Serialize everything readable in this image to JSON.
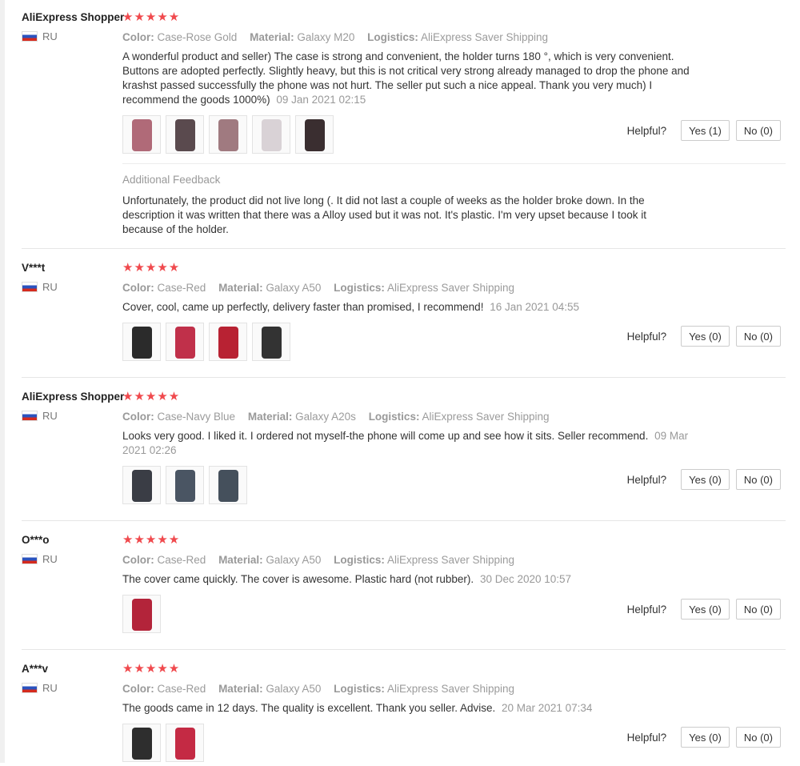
{
  "reviews": [
    {
      "user": "AliExpress Shopper",
      "country": "RU",
      "stars": "★★★★★",
      "color_label": "Color:",
      "color": "Case-Rose Gold",
      "material_label": "Material:",
      "material": "Galaxy M20",
      "logistics_label": "Logistics:",
      "logistics": "AliExpress Saver Shipping",
      "text": "A wonderful product and seller) The case is strong and convenient, the holder turns 180 °, which is very convenient. Buttons are adopted perfectly. Slightly heavy, but this is not critical very strong already managed to drop the phone and krashst passed successfully the phone was not hurt. The seller put such a nice appeal. Thank you very much) I recommend the goods 1000%)",
      "date": "09 Jan 2021 02:15",
      "helpful_label": "Helpful?",
      "yes": "Yes (1)",
      "no": "No (0)",
      "additional_title": "Additional Feedback",
      "additional_text": "Unfortunately, the product did not live long (. It did not last a couple of weeks as the holder broke down. In the description it was written that there was a Alloy used but it was not. It's plastic. I'm very upset because I took it because of the holder.",
      "photo_colors": [
        "#b06a78",
        "#5a4a4e",
        "#a07a80",
        "#d9d2d6",
        "#3a2e30"
      ]
    },
    {
      "user": "V***t",
      "country": "RU",
      "stars": "★★★★★",
      "color_label": "Color:",
      "color": "Case-Red",
      "material_label": "Material:",
      "material": "Galaxy A50",
      "logistics_label": "Logistics:",
      "logistics": "AliExpress Saver Shipping",
      "text": "Cover, cool, came up perfectly, delivery faster than promised, I recommend!",
      "date": "16 Jan 2021 04:55",
      "helpful_label": "Helpful?",
      "yes": "Yes (0)",
      "no": "No (0)",
      "photo_colors": [
        "#2b2b2b",
        "#c0304a",
        "#b82233",
        "#333333"
      ]
    },
    {
      "user": "AliExpress Shopper",
      "country": "RU",
      "stars": "★★★★★",
      "color_label": "Color:",
      "color": "Case-Navy Blue",
      "material_label": "Material:",
      "material": "Galaxy A20s",
      "logistics_label": "Logistics:",
      "logistics": "AliExpress Saver Shipping",
      "text": "Looks very good. I liked it. I ordered not myself-the phone will come up and see how it sits. Seller recommend.",
      "date": "09 Mar 2021 02:26",
      "helpful_label": "Helpful?",
      "yes": "Yes (0)",
      "no": "No (0)",
      "photo_colors": [
        "#3a3d45",
        "#4a5563",
        "#45505c"
      ]
    },
    {
      "user": "O***o",
      "country": "RU",
      "stars": "★★★★★",
      "color_label": "Color:",
      "color": "Case-Red",
      "material_label": "Material:",
      "material": "Galaxy A50",
      "logistics_label": "Logistics:",
      "logistics": "AliExpress Saver Shipping",
      "text": "The cover came quickly. The cover is awesome. Plastic hard (not rubber).",
      "date": "30 Dec 2020 10:57",
      "helpful_label": "Helpful?",
      "yes": "Yes (0)",
      "no": "No (0)",
      "photo_colors": [
        "#b3243a"
      ]
    },
    {
      "user": "A***v",
      "country": "RU",
      "stars": "★★★★★",
      "color_label": "Color:",
      "color": "Case-Red",
      "material_label": "Material:",
      "material": "Galaxy A50",
      "logistics_label": "Logistics:",
      "logistics": "AliExpress Saver Shipping",
      "text": "The goods came in 12 days. The quality is excellent. Thank you seller. Advise.",
      "date": "20 Mar 2021 07:34",
      "helpful_label": "Helpful?",
      "yes": "Yes (0)",
      "no": "No (0)",
      "photo_colors": [
        "#2e2e2e",
        "#c42a44"
      ]
    }
  ]
}
